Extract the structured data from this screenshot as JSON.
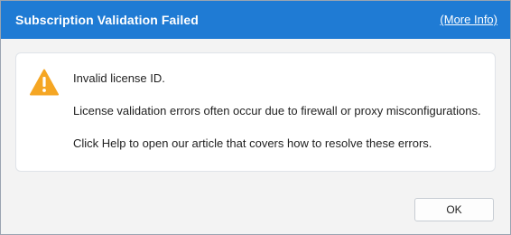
{
  "dialog": {
    "title": "Subscription Validation Failed",
    "more_info_link": "(More Info)",
    "messages": [
      "Invalid license ID.",
      "License validation errors often occur due to firewall or proxy misconfigurations.",
      "Click Help to open our article that covers how to resolve these errors."
    ],
    "icon": "warning-icon",
    "ok_label": "OK"
  },
  "colors": {
    "titlebar": "#1f7bd4",
    "warning": "#f5a623",
    "background": "#f3f3f3"
  }
}
